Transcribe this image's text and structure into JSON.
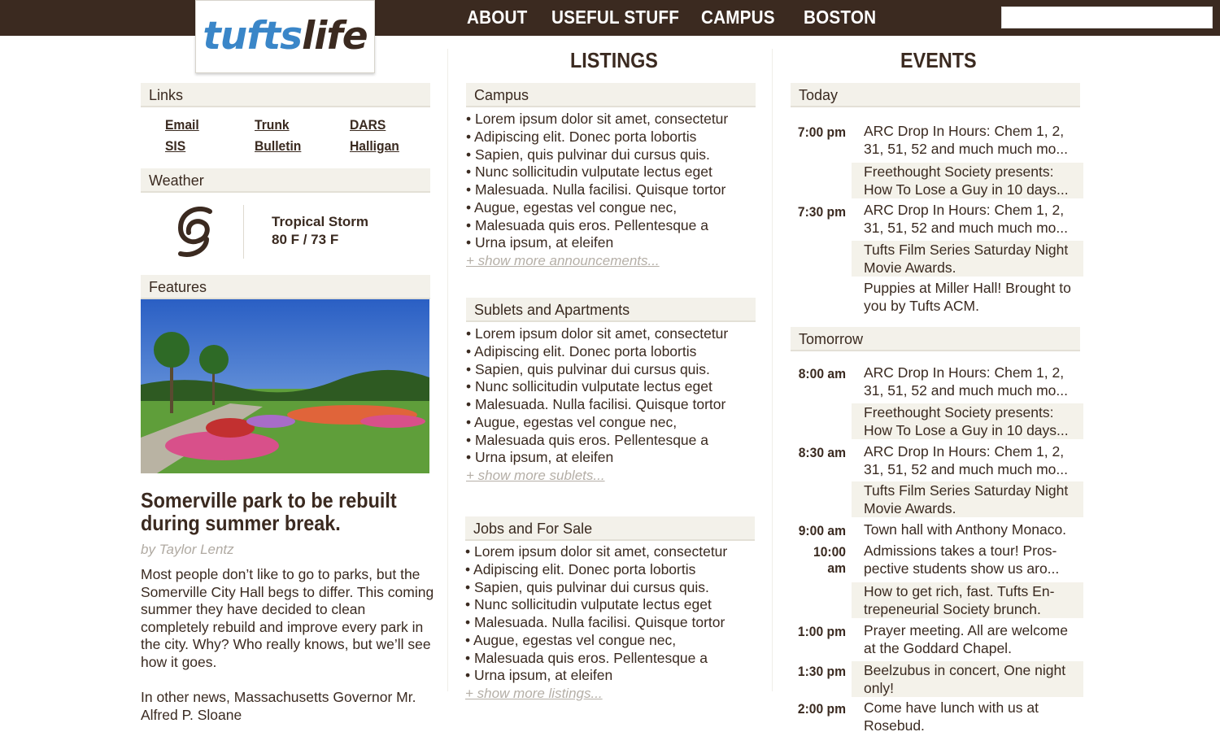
{
  "brand": {
    "part1": "tufts",
    "part2": "life"
  },
  "nav": [
    "ABOUT",
    "USEFUL STUFF",
    "CAMPUS",
    "BOSTON"
  ],
  "search": {
    "placeholder": ""
  },
  "left": {
    "links_header": "Links",
    "links": [
      "Email",
      "Trunk",
      "DARS",
      "SIS",
      "Bulletin",
      "Halligan"
    ],
    "weather_header": "Weather",
    "weather_icon": "tropical-storm-icon",
    "weather_condition": "Tropical Storm",
    "weather_temps": "80 F / 73 F",
    "features_header": "Features",
    "feature_title": "Somerville park to be rebuilt during summer break.",
    "feature_byline": "by Taylor Lentz",
    "feature_p1": "Most people don’t like to go to parks, but the Somerville City Hall begs to differ. This coming summer they have decided to clean completely rebuild and improve every park in the city. Why? Who really knows, but we’ll see how it goes.",
    "feature_p2": "In other news, Massachusetts Governor Mr. Alfred P. Sloane"
  },
  "listings": {
    "title": "LISTINGS",
    "sections": [
      {
        "header": "Campus",
        "items": [
          "Lorem ipsum dolor sit amet, consectetur",
          "Adipiscing elit. Donec porta lobortis",
          "Sapien, quis pulvinar dui cursus quis.",
          "Nunc sollicitudin vulputate lectus eget",
          "Malesuada. Nulla facilisi. Quisque tortor",
          "Augue, egestas vel congue nec,",
          "Malesuada quis eros. Pellentesque a",
          "Urna ipsum, at eleifen"
        ],
        "more": "+ show more announcements..."
      },
      {
        "header": "Sublets and Apartments",
        "items": [
          "Lorem ipsum dolor sit amet, consectetur",
          "Adipiscing elit. Donec porta lobortis",
          "Sapien, quis pulvinar dui cursus quis.",
          "Nunc sollicitudin vulputate lectus eget",
          "Malesuada. Nulla facilisi. Quisque tortor",
          "Augue, egestas vel congue nec,",
          "Malesuada quis eros. Pellentesque a",
          "Urna ipsum, at eleifen"
        ],
        "more": "+ show more sublets..."
      },
      {
        "header": "Jobs and For Sale",
        "items": [
          "Lorem ipsum dolor sit amet, consectetur",
          "Adipiscing elit. Donec porta lobortis",
          "Sapien, quis pulvinar dui cursus quis.",
          "Nunc sollicitudin vulputate lectus eget",
          "Malesuada. Nulla facilisi. Quisque tortor",
          "Augue, egestas vel congue nec,",
          "Malesuada quis eros. Pellentesque a",
          "Urna ipsum, at eleifen"
        ],
        "more": "+ show more listings..."
      }
    ]
  },
  "events": {
    "title": "EVENTS",
    "today_header": "Today",
    "tomorrow_header": "Tomorrow",
    "today_times": [
      "7:00 pm",
      "7:30 pm"
    ],
    "tomorrow_times": [
      "8:00 am",
      "8:30 am",
      "9:00 am",
      "10:00 am",
      "1:00 pm",
      "1:30 pm",
      "2:00 pm"
    ],
    "today": [
      "ARC Drop In Hours: Chem 1, 2, 31, 51, 52 and much much mo...",
      "Freethought Society presents: How To Lose a Guy in 10 days...",
      "ARC Drop In Hours: Chem 1, 2, 31, 51, 52 and much much mo...",
      "Tufts Film Series Saturday Night Movie Awards.",
      "Puppies at Miller Hall! Brought to you by Tufts ACM."
    ],
    "tomorrow": [
      "ARC Drop In Hours: Chem 1, 2, 31, 51, 52 and much much mo...",
      "Freethought Society presents: How To Lose a Guy in 10 days...",
      "ARC Drop In Hours: Chem 1, 2, 31, 51, 52 and much much mo...",
      "Tufts Film Series Saturday Night Movie Awards.",
      "Town hall with Anthony Monaco.",
      "Admissions takes a tour! Pros-pective students show us aro...",
      "How to get rich, fast. Tufts En-trepeneurial Society brunch.",
      "Prayer meeting. All are welcome at the Goddard Chapel.",
      "Beelzubus in concert, One night only!",
      "Come have lunch with us at Rosebud."
    ]
  }
}
